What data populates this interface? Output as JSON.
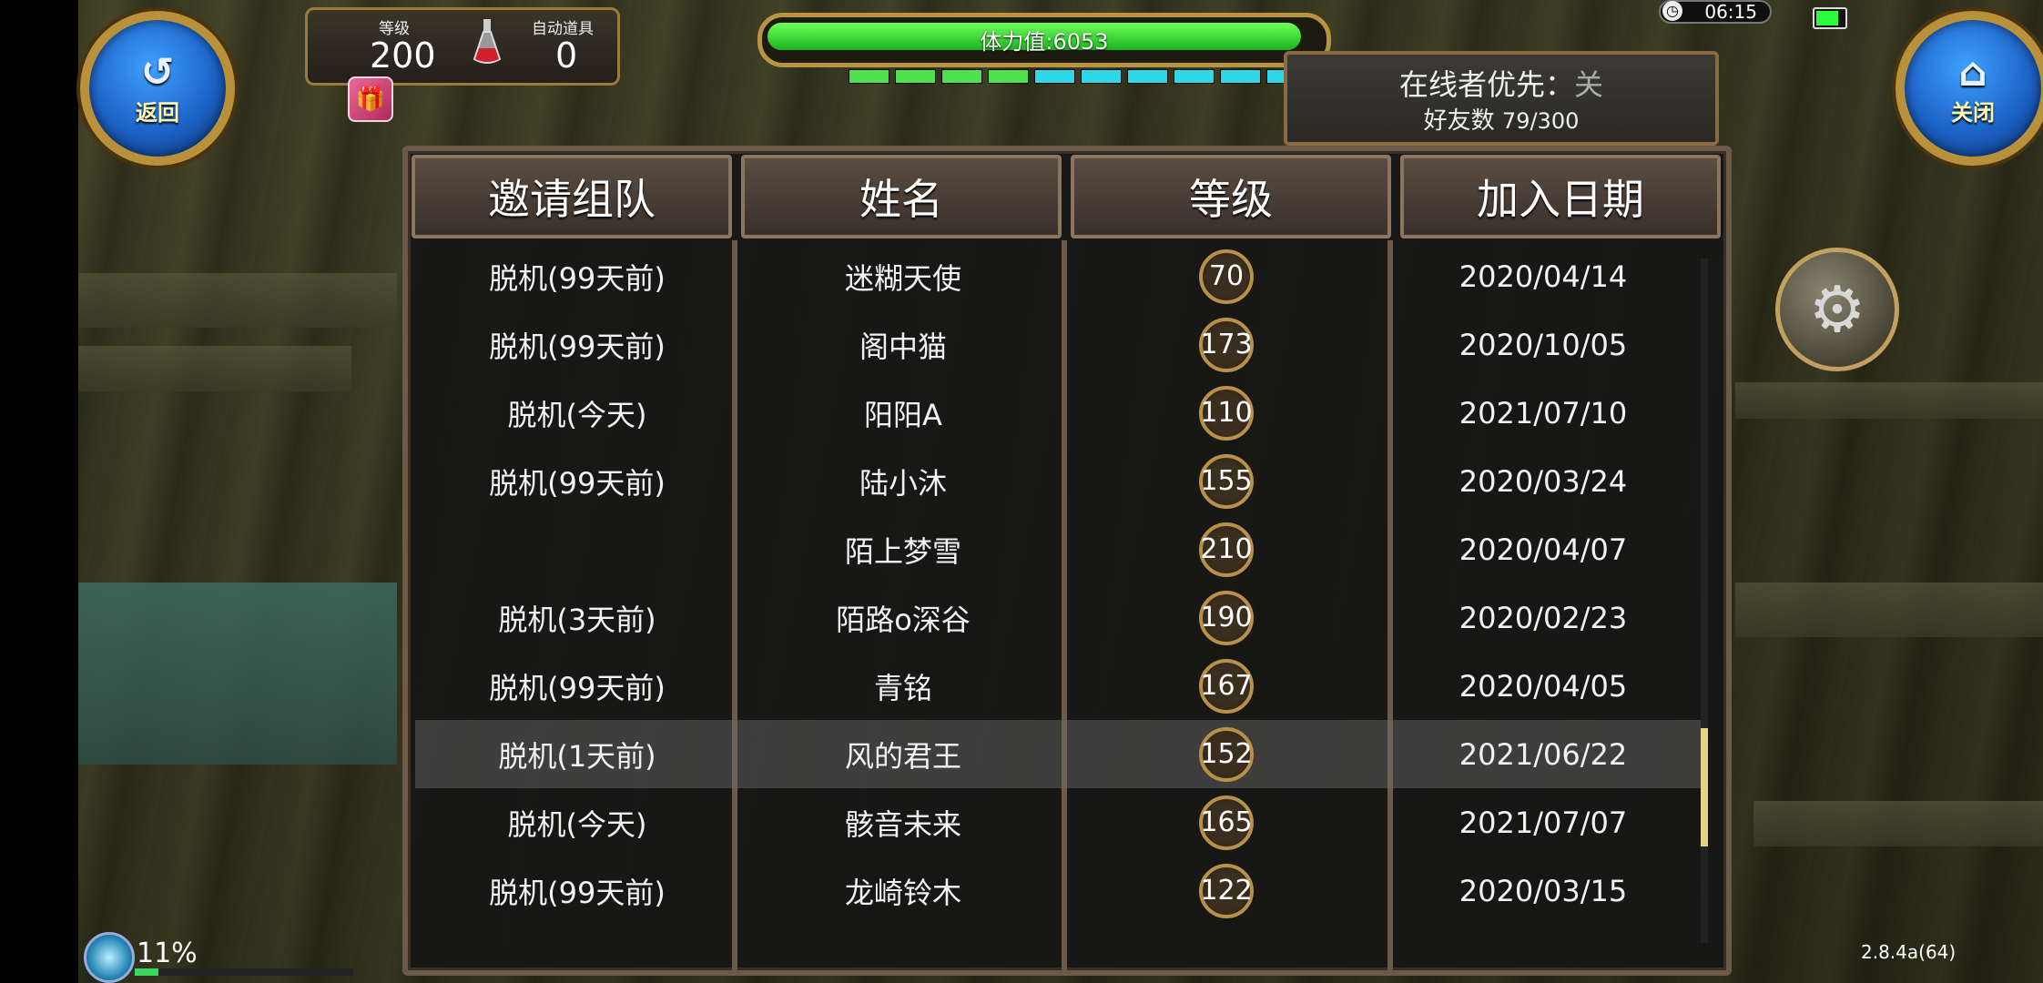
{
  "nav": {
    "back_label": "返回",
    "close_label": "关闭"
  },
  "player": {
    "level_label": "等级",
    "level_value": "200",
    "auto_item_label": "自动道具",
    "auto_item_value": "0"
  },
  "stamina": {
    "label": "体力值:6053",
    "fill_fraction": 0.98
  },
  "segments": {
    "colors": [
      "#4fe24f",
      "#4fe24f",
      "#4fe24f",
      "#4fe24f",
      "#2fd8e8",
      "#2fd8e8",
      "#2fd8e8",
      "#2fd8e8",
      "#2fd8e8",
      "#2fd8e8"
    ]
  },
  "status": {
    "time": "06:15",
    "battery_fraction": 0.8
  },
  "online_panel": {
    "priority_label": "在线者优先：",
    "priority_value": "关",
    "friends_label": "好友数",
    "friends_count": "79/300"
  },
  "table": {
    "headers": [
      "邀请组队",
      "姓名",
      "等级",
      "加入日期"
    ],
    "rows": [
      {
        "status": "脱机(99天前)",
        "name": "迷糊天使",
        "level": "70",
        "date": "2020/04/14"
      },
      {
        "status": "脱机(99天前)",
        "name": "阁中猫",
        "level": "173",
        "date": "2020/10/05"
      },
      {
        "status": "脱机(今天)",
        "name": "阳阳A",
        "level": "110",
        "date": "2021/07/10"
      },
      {
        "status": "脱机(99天前)",
        "name": "陆小沐",
        "level": "155",
        "date": "2020/03/24"
      },
      {
        "status": "",
        "name": "陌上梦雪",
        "level": "210",
        "date": "2020/04/07"
      },
      {
        "status": "脱机(3天前)",
        "name": "陌路o深谷",
        "level": "190",
        "date": "2020/02/23"
      },
      {
        "status": "脱机(99天前)",
        "name": "青铭",
        "level": "167",
        "date": "2020/04/05"
      },
      {
        "status": "脱机(1天前)",
        "name": "风的君王",
        "level": "152",
        "date": "2021/06/22",
        "selected": true
      },
      {
        "status": "脱机(今天)",
        "name": "骸音未来",
        "level": "165",
        "date": "2021/07/07"
      },
      {
        "status": "脱机(99天前)",
        "name": "龙崎铃木",
        "level": "122",
        "date": "2020/03/15"
      }
    ],
    "scroll_position": 0.83
  },
  "loading": {
    "percent_label": "11%",
    "fraction": 0.11
  },
  "version": "2.8.4a(64)",
  "colors": {
    "frame": "#6b5a48",
    "gold": "#b8913a",
    "stamina": "#2cd82c",
    "selected_row": "#6e6e6e"
  }
}
